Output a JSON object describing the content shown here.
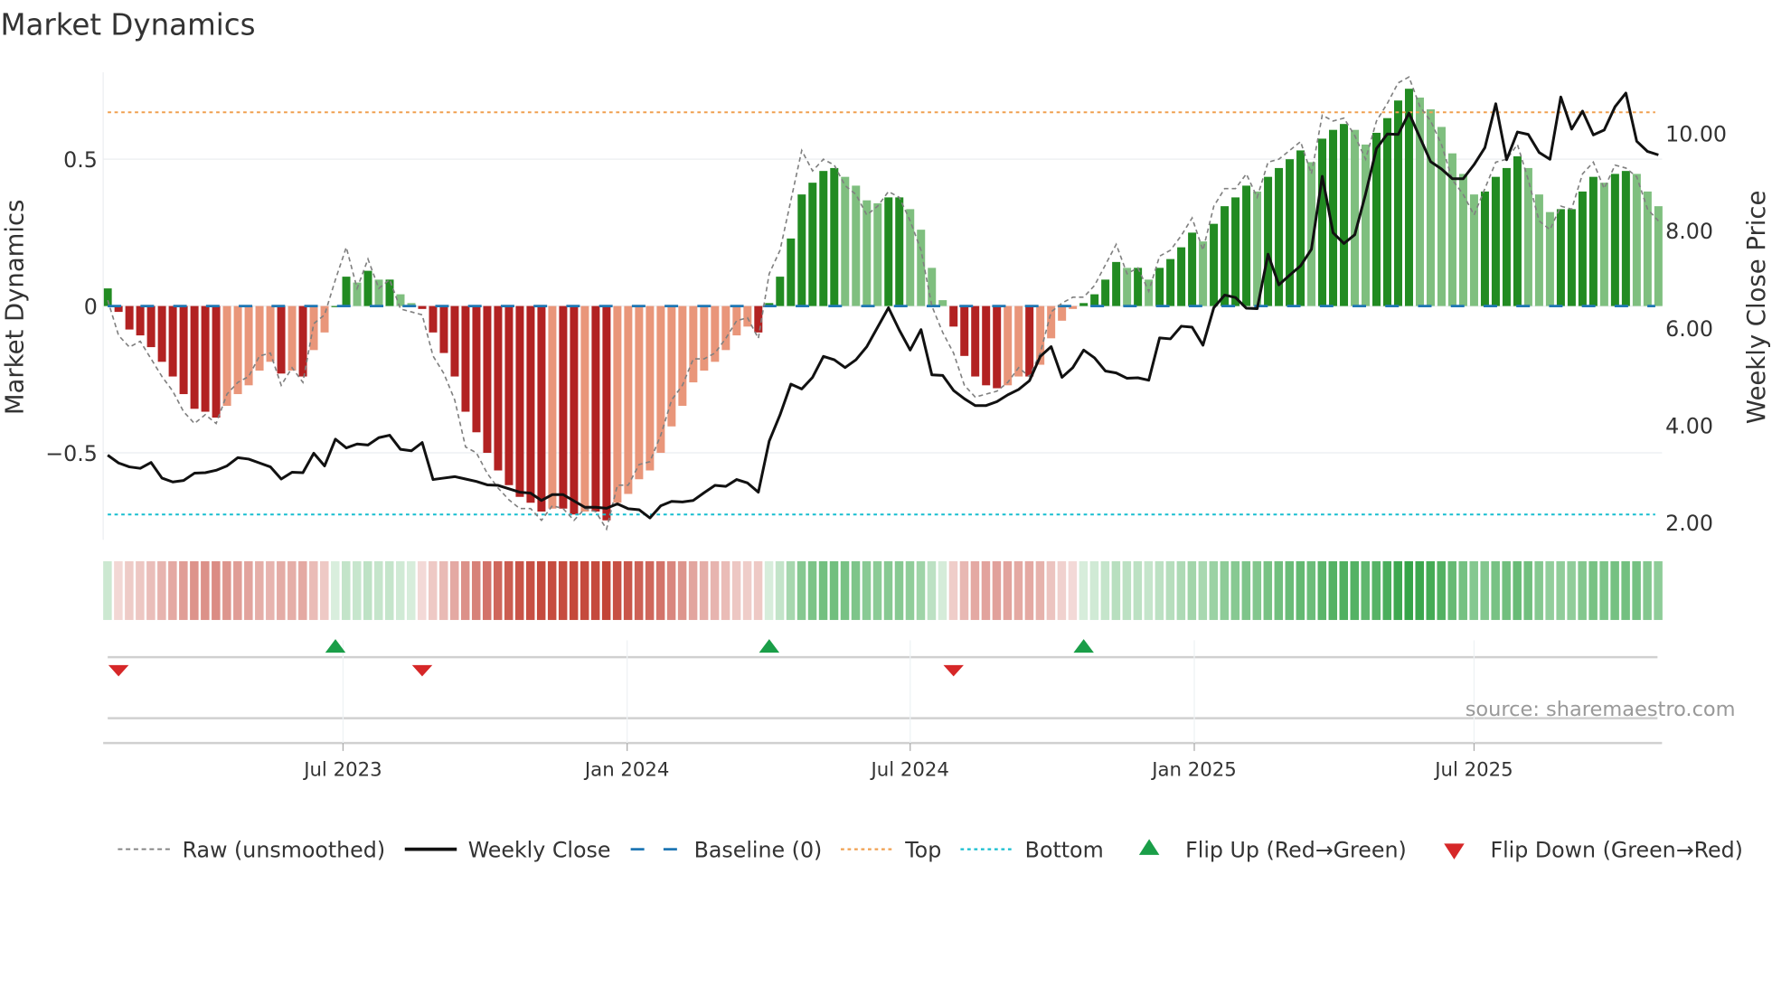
{
  "chart_data": {
    "type": "bar",
    "title": "Market Dynamics",
    "ylabel": "Market Dynamics",
    "y2label": "Weekly Close Price",
    "ylim": [
      -0.8,
      0.8
    ],
    "y2lim": [
      2.0,
      11.0
    ],
    "yticks": [
      {
        "value": 0.5,
        "label": "0.5"
      },
      {
        "value": 0,
        "label": "0"
      },
      {
        "value": -0.5,
        "label": "−0.5"
      }
    ],
    "y2ticks": [
      {
        "value": 10,
        "label": "10.00"
      },
      {
        "value": 8,
        "label": "8.00"
      },
      {
        "value": 6,
        "label": "6.00"
      },
      {
        "value": 4,
        "label": "4.00"
      },
      {
        "value": 2,
        "label": "2.00"
      }
    ],
    "xticks": [
      {
        "week_index": 21.7,
        "label": "Jul 2023"
      },
      {
        "week_index": 47.9,
        "label": "Jan 2024"
      },
      {
        "week_index": 74.0,
        "label": "Jul 2024"
      },
      {
        "week_index": 100.2,
        "label": "Jan 2025"
      },
      {
        "week_index": 126.0,
        "label": "Jul 2025"
      }
    ],
    "top_level": 0.66,
    "bottom_level": -0.71,
    "baseline": 0,
    "smoothed": [
      0.06,
      -0.02,
      -0.08,
      -0.1,
      -0.14,
      -0.19,
      -0.24,
      -0.3,
      -0.35,
      -0.36,
      -0.38,
      -0.34,
      -0.3,
      -0.27,
      -0.22,
      -0.19,
      -0.23,
      -0.22,
      -0.24,
      -0.15,
      -0.09,
      0.0,
      0.1,
      0.08,
      0.12,
      0.09,
      0.09,
      0.04,
      0.01,
      -0.01,
      -0.09,
      -0.16,
      -0.24,
      -0.36,
      -0.43,
      -0.5,
      -0.56,
      -0.61,
      -0.65,
      -0.67,
      -0.7,
      -0.69,
      -0.69,
      -0.71,
      -0.7,
      -0.7,
      -0.73,
      -0.67,
      -0.64,
      -0.59,
      -0.56,
      -0.5,
      -0.41,
      -0.34,
      -0.26,
      -0.22,
      -0.19,
      -0.15,
      -0.1,
      -0.07,
      -0.09,
      0.01,
      0.1,
      0.23,
      0.38,
      0.42,
      0.46,
      0.47,
      0.44,
      0.41,
      0.36,
      0.35,
      0.37,
      0.37,
      0.33,
      0.26,
      0.13,
      0.02,
      -0.07,
      -0.17,
      -0.24,
      -0.27,
      -0.28,
      -0.27,
      -0.24,
      -0.24,
      -0.2,
      -0.11,
      -0.05,
      -0.01,
      0.01,
      0.04,
      0.09,
      0.15,
      0.13,
      0.13,
      0.09,
      0.13,
      0.16,
      0.2,
      0.25,
      0.22,
      0.28,
      0.34,
      0.37,
      0.41,
      0.39,
      0.44,
      0.47,
      0.5,
      0.53,
      0.49,
      0.57,
      0.6,
      0.62,
      0.6,
      0.55,
      0.59,
      0.64,
      0.7,
      0.74,
      0.71,
      0.67,
      0.61,
      0.52,
      0.45,
      0.38,
      0.39,
      0.44,
      0.47,
      0.51,
      0.47,
      0.38,
      0.32,
      0.33,
      0.33,
      0.39,
      0.44,
      0.42,
      0.45,
      0.46,
      0.45,
      0.39,
      0.34
    ],
    "raw": [
      0.02,
      -0.1,
      -0.14,
      -0.12,
      -0.18,
      -0.24,
      -0.29,
      -0.36,
      -0.4,
      -0.37,
      -0.4,
      -0.3,
      -0.26,
      -0.24,
      -0.17,
      -0.16,
      -0.27,
      -0.21,
      -0.26,
      -0.06,
      -0.03,
      0.09,
      0.2,
      0.06,
      0.16,
      0.06,
      0.09,
      -0.01,
      -0.02,
      -0.03,
      -0.17,
      -0.23,
      -0.32,
      -0.48,
      -0.5,
      -0.57,
      -0.62,
      -0.66,
      -0.69,
      -0.69,
      -0.73,
      -0.68,
      -0.69,
      -0.73,
      -0.69,
      -0.7,
      -0.76,
      -0.61,
      -0.61,
      -0.54,
      -0.53,
      -0.44,
      -0.32,
      -0.27,
      -0.18,
      -0.18,
      -0.16,
      -0.11,
      -0.05,
      -0.04,
      -0.11,
      0.11,
      0.19,
      0.36,
      0.53,
      0.46,
      0.5,
      0.48,
      0.41,
      0.38,
      0.31,
      0.34,
      0.39,
      0.37,
      0.29,
      0.19,
      0.0,
      -0.09,
      -0.16,
      -0.27,
      -0.31,
      -0.3,
      -0.29,
      -0.26,
      -0.21,
      -0.24,
      -0.16,
      -0.02,
      0.01,
      0.03,
      0.03,
      0.07,
      0.14,
      0.21,
      0.11,
      0.13,
      0.05,
      0.17,
      0.19,
      0.24,
      0.3,
      0.19,
      0.34,
      0.4,
      0.4,
      0.45,
      0.37,
      0.49,
      0.5,
      0.53,
      0.56,
      0.45,
      0.65,
      0.63,
      0.64,
      0.58,
      0.5,
      0.63,
      0.69,
      0.76,
      0.78,
      0.68,
      0.63,
      0.55,
      0.43,
      0.38,
      0.31,
      0.4,
      0.49,
      0.5,
      0.55,
      0.43,
      0.29,
      0.26,
      0.34,
      0.33,
      0.45,
      0.49,
      0.4,
      0.48,
      0.47,
      0.44,
      0.33,
      0.29
    ],
    "close": [
      3.39,
      3.23,
      3.15,
      3.12,
      3.24,
      2.92,
      2.84,
      2.87,
      3.02,
      3.03,
      3.08,
      3.17,
      3.34,
      3.31,
      3.23,
      3.15,
      2.9,
      3.04,
      3.03,
      3.43,
      3.17,
      3.72,
      3.54,
      3.62,
      3.6,
      3.75,
      3.8,
      3.51,
      3.48,
      3.65,
      2.89,
      2.92,
      2.95,
      2.9,
      2.85,
      2.78,
      2.77,
      2.7,
      2.63,
      2.61,
      2.46,
      2.58,
      2.58,
      2.45,
      2.32,
      2.32,
      2.3,
      2.39,
      2.29,
      2.27,
      2.1,
      2.35,
      2.44,
      2.43,
      2.46,
      2.62,
      2.77,
      2.75,
      2.89,
      2.82,
      2.63,
      3.68,
      4.22,
      4.85,
      4.75,
      4.99,
      5.42,
      5.35,
      5.19,
      5.35,
      5.62,
      6.02,
      6.42,
      5.96,
      5.55,
      5.97,
      5.04,
      5.03,
      4.72,
      4.55,
      4.41,
      4.41,
      4.49,
      4.63,
      4.74,
      4.92,
      5.42,
      5.62,
      4.99,
      5.19,
      5.55,
      5.39,
      5.12,
      5.08,
      4.97,
      4.98,
      4.93,
      5.8,
      5.78,
      6.04,
      6.02,
      5.65,
      6.42,
      6.68,
      6.63,
      6.41,
      6.4,
      7.52,
      6.89,
      7.09,
      7.28,
      7.62,
      9.12,
      7.96,
      7.74,
      7.92,
      8.76,
      9.69,
      9.99,
      9.98,
      10.42,
      9.92,
      9.42,
      9.27,
      9.07,
      9.07,
      9.36,
      9.71,
      10.61,
      9.46,
      10.03,
      9.98,
      9.61,
      9.47,
      10.75,
      10.09,
      10.46,
      9.97,
      10.07,
      10.55,
      10.83,
      9.84,
      9.63,
      9.56
    ],
    "flip_up_weeks": [
      21,
      61,
      90
    ],
    "flip_down_weeks": [
      1,
      29,
      78
    ],
    "colors": {
      "pos_rising": "#228b22",
      "pos_falling": "#7fbf7f",
      "neg_falling": "#b22222",
      "neg_rising": "#e9967a",
      "raw": "#808080",
      "close": "#111111",
      "baseline": "#1f77b4",
      "top": "#f0a050",
      "bottom": "#17becf",
      "flip_up": "#1a9e48",
      "flip_down": "#d62728"
    },
    "legend": {
      "placement": "bottom",
      "entries": [
        "Raw (unsmoothed)",
        "Weekly Close",
        "Baseline (0)",
        "Top",
        "Bottom",
        "Flip Up (Red→Green)",
        "Flip Down (Green→Red)"
      ]
    },
    "source": "source: sharemaestro.com"
  }
}
